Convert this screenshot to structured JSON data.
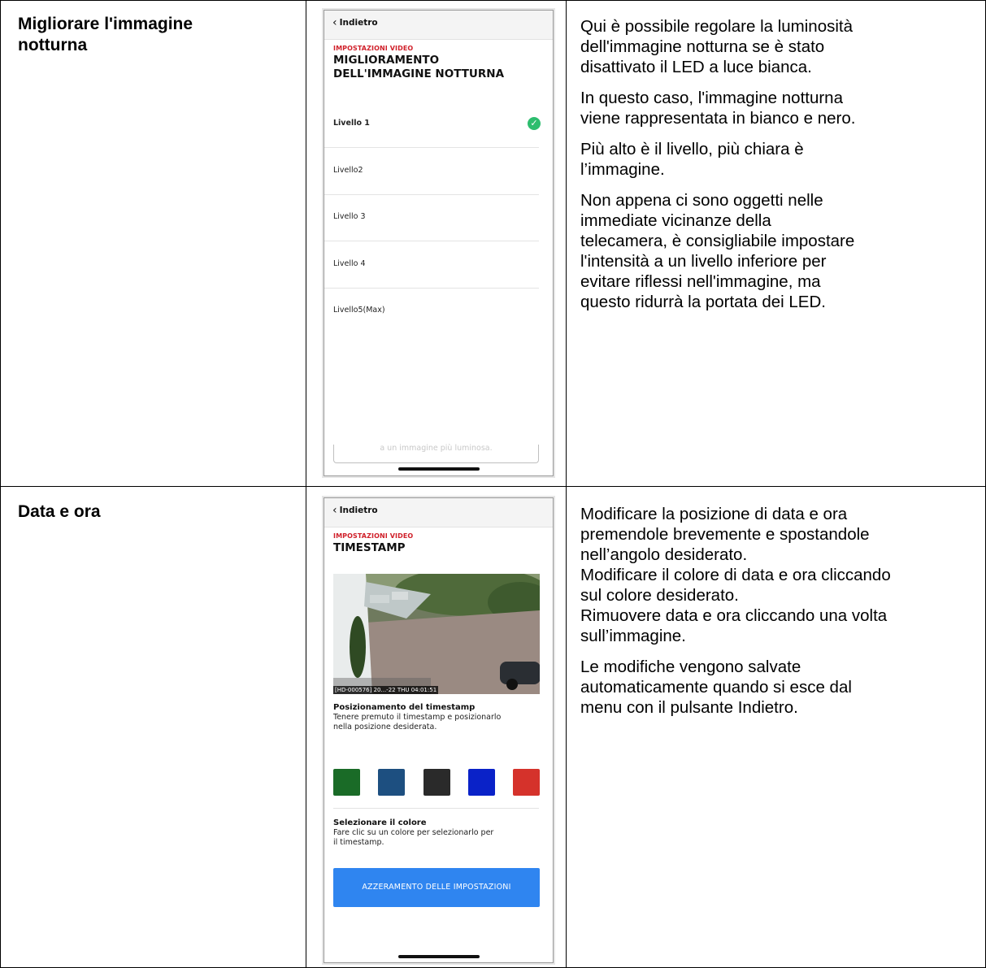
{
  "rows": [
    {
      "title": "Migliorare l'immagine notturna",
      "title_lines": [
        "Migliorare l'immagine",
        "notturna"
      ],
      "paragraphs": [
        [
          "Qui è possibile regolare la luminosità",
          "dell'immagine notturna se è stato",
          "disattivato il LED a luce bianca."
        ],
        [
          "In questo caso, l'immagine notturna",
          "viene rappresentata in bianco e nero."
        ],
        [
          "Più alto è il livello, più chiara è",
          "l’immagine."
        ],
        [
          "Non appena ci sono oggetti nelle",
          "immediate vicinanze della",
          "telecamera, è consigliabile impostare",
          "l'intensità a un livello inferiore per",
          "evitare riflessi nell'immagine, ma",
          "questo ridurrà la portata dei LED."
        ]
      ],
      "phone": {
        "back_label": "Indietro",
        "kicker": "IMPOSTAZIONI VIDEO",
        "title_lines": [
          "MIGLIORAMENTO",
          "DELL'IMMAGINE NOTTURNA"
        ],
        "levels": [
          "Livello 1",
          "Livello2",
          "Livello 3",
          "Livello 4",
          "Livello5(Max)"
        ],
        "selected_index": 0,
        "hint_text": "a un immagine più luminosa."
      }
    },
    {
      "title": "Data e ora",
      "paragraphs": [
        [
          "Modificare la posizione di data e ora",
          "premendole brevemente e spostandole",
          "nell’angolo desiderato.",
          "Modificare il colore di data e ora cliccando",
          "sul colore desiderato.",
          "Rimuovere data e ora cliccando una volta",
          "sull’immagine."
        ],
        [
          "Le modifiche vengono salvate",
          "automaticamente quando si esce dal",
          "menu con il pulsante Indietro."
        ]
      ],
      "phone": {
        "back_label": "Indietro",
        "kicker": "IMPOSTAZIONI VIDEO",
        "title": "TIMESTAMP",
        "osd_text": "[HD-000576] 20...-22 THU 04:01:51",
        "position_heading": "Posizionamento del timestamp",
        "position_text_lines": [
          "Tenere premuto il timestamp e posizionarlo",
          "nella posizione desiderata."
        ],
        "swatches": [
          "#1a6b27",
          "#1d4f80",
          "#2a2a2a",
          "#0a22c8",
          "#d5322b"
        ],
        "color_heading": "Selezionare il colore",
        "color_text_lines": [
          "Fare clic su un colore per selezionarlo per",
          "il timestamp."
        ],
        "reset_label": "AZZERAMENTO DELLE IMPOSTAZIONI"
      }
    }
  ]
}
